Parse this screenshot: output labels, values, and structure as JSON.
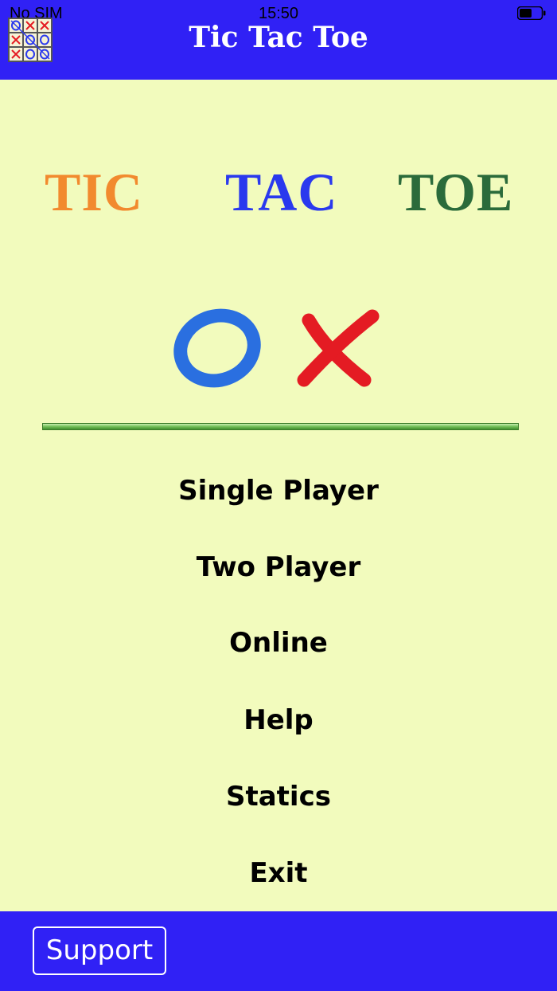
{
  "status_bar": {
    "carrier": "No SIM",
    "time": "15:50",
    "battery_icon": "battery-icon"
  },
  "header": {
    "title": "Tic Tac Toe",
    "app_icon": "tic-tac-toe-board-icon"
  },
  "logo": {
    "word1": "TIC",
    "word2": "TAC",
    "word3": "TOE",
    "symbols": [
      "O",
      "X"
    ]
  },
  "menu": {
    "items": [
      {
        "label": "Single Player"
      },
      {
        "label": "Two Player"
      },
      {
        "label": "Online"
      },
      {
        "label": "Help"
      },
      {
        "label": "Statics"
      },
      {
        "label": "Exit"
      }
    ]
  },
  "footer": {
    "support_label": "Support"
  },
  "colors": {
    "bar_blue": "#3021f5",
    "background": "#f2fbbd",
    "tic_orange": "#f28a2e",
    "tac_blue": "#2a39ee",
    "toe_green": "#2b6b3b",
    "o_blue": "#2a6fe0",
    "x_red": "#e41b23"
  }
}
